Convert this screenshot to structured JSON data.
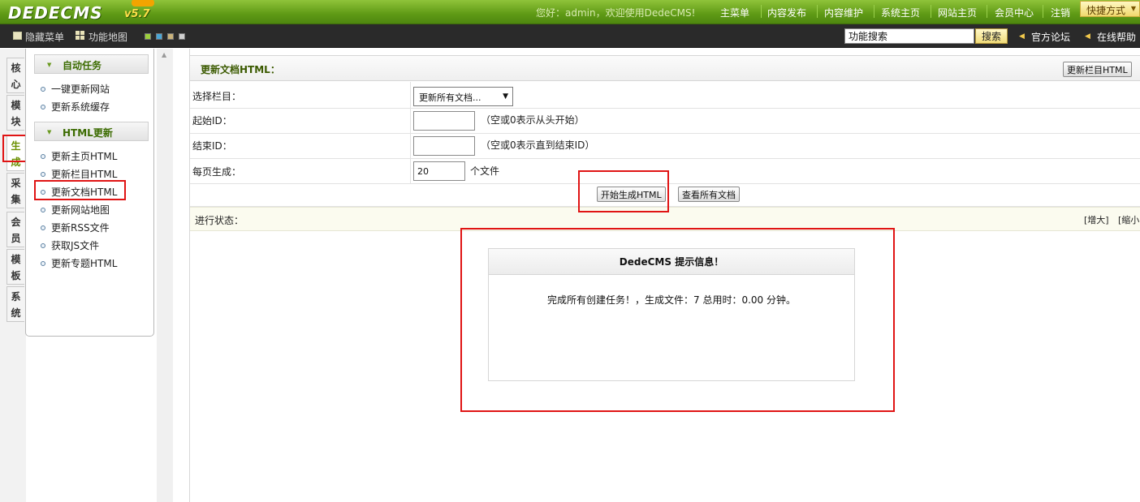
{
  "header": {
    "logo": "DEDECMS",
    "version": "v5.7",
    "welcome_prefix": "您好：",
    "username": "admin",
    "welcome_suffix": "，欢迎使用DedeCMS!",
    "nav": [
      "主菜单",
      "内容发布",
      "内容维护",
      "系统主页",
      "网站主页",
      "会员中心",
      "注销"
    ],
    "quick_label": "快捷方式"
  },
  "toolbar": {
    "hide_menu": "隐藏菜单",
    "function_map": "功能地图",
    "swatch_colors": [
      "#9ccf3c",
      "#4aa6d6",
      "#c9b27a",
      "#cfcfcf"
    ],
    "search_value": "功能搜索",
    "search_button": "搜索",
    "forum": "官方论坛",
    "help": "在线帮助"
  },
  "tabs": [
    "核心",
    "模块",
    "生成",
    "采集",
    "会员",
    "模板",
    "系统"
  ],
  "menu": {
    "section1": {
      "title": "自动任务",
      "items": [
        "一键更新网站",
        "更新系统缓存"
      ]
    },
    "section2": {
      "title": "HTML更新",
      "items": [
        "更新主页HTML",
        "更新栏目HTML",
        "更新文档HTML",
        "更新网站地图",
        "更新RSS文件",
        "获取JS文件",
        "更新专题HTML"
      ]
    }
  },
  "main": {
    "title": "更新文档HTML：",
    "update_column_button": "更新栏目HTML",
    "rows": {
      "column_label": "选择栏目：",
      "column_value": "更新所有文档...",
      "start_label": "起始ID：",
      "start_value": "",
      "start_hint": "（空或0表示从头开始）",
      "end_label": "结束ID：",
      "end_value": "",
      "end_hint": "（空或0表示直到结束ID）",
      "per_page_label": "每页生成：",
      "per_page_value": "20",
      "per_page_unit": "个文件"
    },
    "start_button": "开始生成HTML",
    "view_all_button": "查看所有文档",
    "status_label": "进行状态：",
    "zoom_in": "[增大]",
    "zoom_out": "[缩小"
  },
  "message": {
    "title": "DedeCMS 提示信息！",
    "text": "完成所有创建任务！，生成文件：7 总用时：0.00 分钟。"
  }
}
